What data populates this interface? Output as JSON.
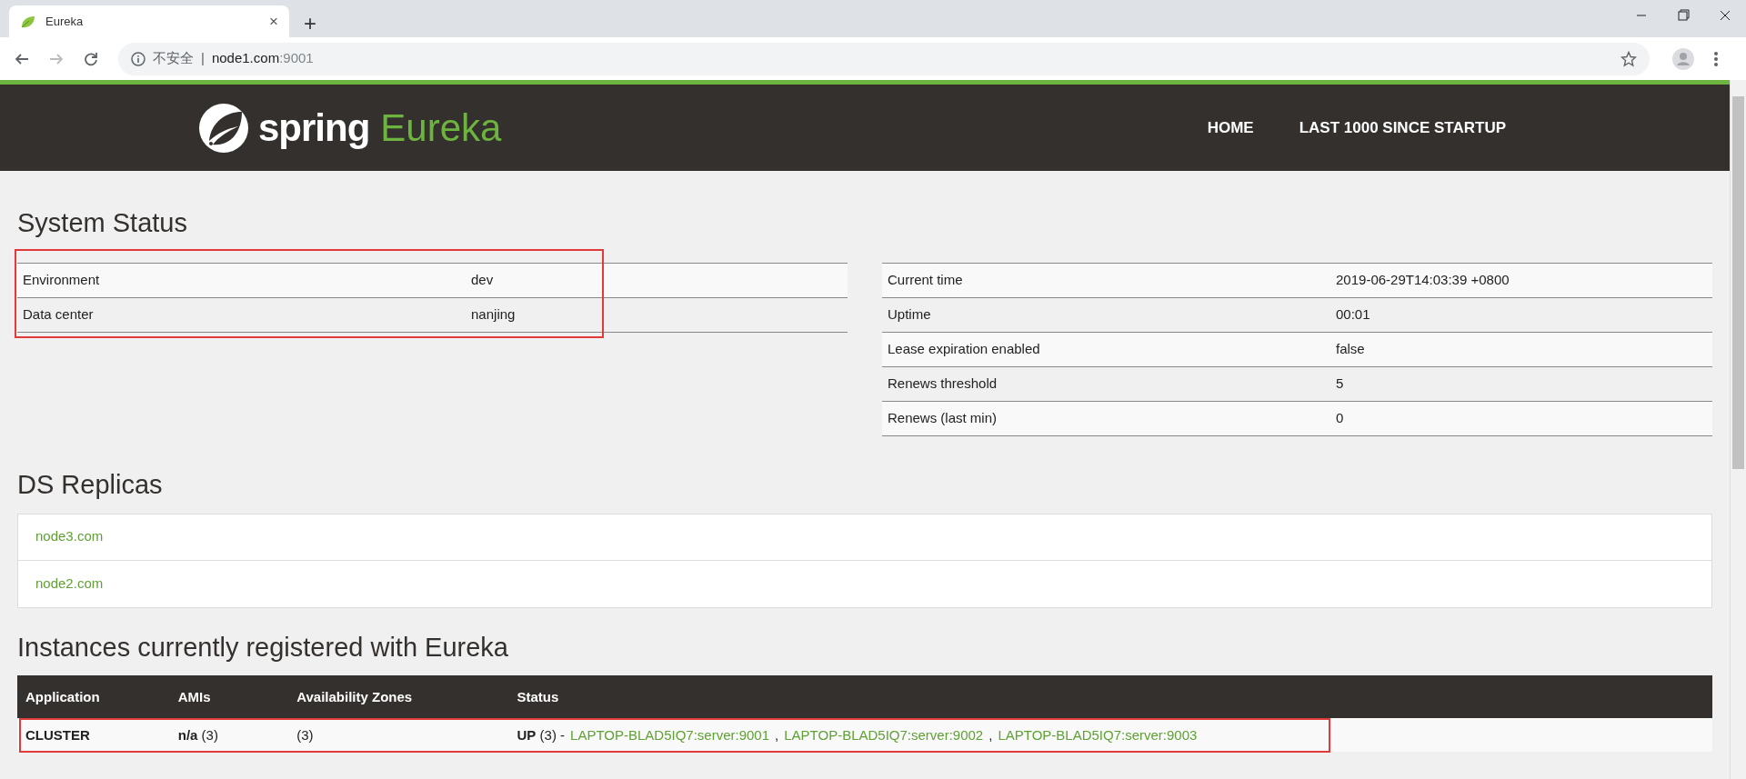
{
  "browser": {
    "tab": {
      "title": "Eureka",
      "close": "×",
      "selected": true
    },
    "new_tab": "+",
    "nav_buttons": [
      {
        "kind": "back",
        "disabled": false
      },
      {
        "kind": "forward",
        "disabled": true
      },
      {
        "kind": "reload",
        "disabled": false
      }
    ],
    "address": {
      "security": "不安全",
      "divider": "|",
      "host": "node1.com",
      "port": ":9001"
    }
  },
  "header": {
    "brand": "spring",
    "product": "Eureka",
    "nav": [
      {
        "label": "HOME"
      },
      {
        "label": "LAST 1000 SINCE STARTUP"
      }
    ]
  },
  "system_status": {
    "title": "System Status",
    "left": {
      "annotated": true,
      "rows": [
        {
          "label": "Environment",
          "value": "dev"
        },
        {
          "label": "Data center",
          "value": "nanjing"
        }
      ]
    },
    "right": {
      "annotated": false,
      "rows": [
        {
          "label": "Current time",
          "value": "2019-06-29T14:03:39 +0800"
        },
        {
          "label": "Uptime",
          "value": "00:01"
        },
        {
          "label": "Lease expiration enabled",
          "value": "false"
        },
        {
          "label": "Renews threshold",
          "value": "5"
        },
        {
          "label": "Renews (last min)",
          "value": "0"
        }
      ]
    }
  },
  "ds_replicas": {
    "title": "DS Replicas",
    "items": [
      "node3.com",
      "node2.com"
    ]
  },
  "instances": {
    "title": "Instances currently registered with Eureka",
    "columns": [
      "Application",
      "AMIs",
      "Availability Zones",
      "Status"
    ],
    "rows": [
      {
        "annotated": true,
        "application": "CLUSTER",
        "amis": "**n/a** (3)",
        "zones": "(3)",
        "status": "**UP** (3) -",
        "links": [
          {
            "text": "LAPTOP-BLAD5IQ7:server:9001",
            "trail": ","
          },
          {
            "text": "LAPTOP-BLAD5IQ7:server:9002",
            "trail": ","
          },
          {
            "text": "LAPTOP-BLAD5IQ7:server:9003"
          }
        ]
      }
    ]
  }
}
